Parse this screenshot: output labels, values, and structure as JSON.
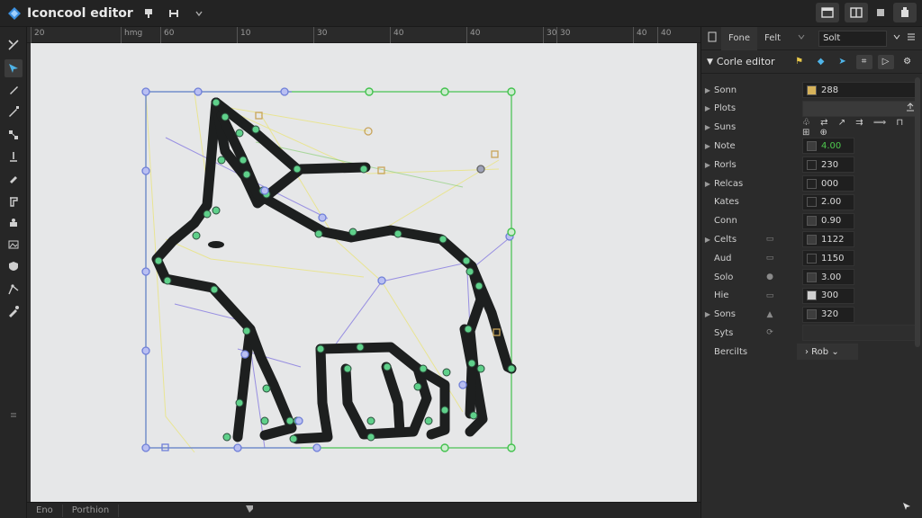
{
  "app": {
    "title": "Iconcool editor"
  },
  "titlebar": {
    "tools": [
      "pin-icon",
      "H",
      "chevron-down-icon"
    ]
  },
  "ruler": {
    "labels": [
      "20",
      "hmg",
      "60",
      "10",
      "30",
      "40",
      "40",
      "30",
      "30",
      "40",
      "40"
    ]
  },
  "statusbar": {
    "left": "Eno",
    "right": "Porthion"
  },
  "panel": {
    "tabs": [
      "Fone",
      "Felt"
    ],
    "select_value": "Solt",
    "section_title": "Corle editor",
    "rows": [
      {
        "label": "Sonn",
        "value": "288",
        "swatch": "#d6b25a",
        "caret": true
      },
      {
        "label": "Plots",
        "value": "",
        "caret": true
      },
      {
        "label": "Suns",
        "value": "",
        "caret": true
      },
      {
        "label": "Note",
        "value": "4.00",
        "swatch": "#3d3d3d",
        "caret": true,
        "value_color": "#4ec94e"
      },
      {
        "label": "Rorls",
        "value": "230",
        "swatch": "#222222",
        "caret": true
      },
      {
        "label": "Relcas",
        "value": "000",
        "swatch": "#222222",
        "caret": true
      },
      {
        "label": "Kates",
        "value": "2.00",
        "swatch": "#222222",
        "caret": false
      },
      {
        "label": "Conn",
        "value": "0.90",
        "swatch": "#3d3d3d",
        "caret": false
      },
      {
        "label": "Celts",
        "value": "1122",
        "swatch": "#3d3d3d",
        "caret": true
      },
      {
        "label": "Aud",
        "value": "1150",
        "swatch": "#222222",
        "caret": false
      },
      {
        "label": "Solo",
        "value": "3.00",
        "swatch": "#3d3d3d",
        "caret": false
      },
      {
        "label": "Hie",
        "value": "300",
        "swatch": "#d0d0d0",
        "caret": false
      },
      {
        "label": "Sons",
        "value": "320",
        "swatch": "#3d3d3d",
        "caret": true
      },
      {
        "label": "Syts",
        "value": "",
        "caret": false
      },
      {
        "label": "Bercilts",
        "value": "Rob",
        "caret": false
      }
    ]
  },
  "colors": {
    "accent_green": "#43c24e",
    "node_blue": "#6f7fd8",
    "node_green": "#5fd08a",
    "stroke": "#1d1f1f",
    "guide_yellow": "#e9e48a"
  }
}
